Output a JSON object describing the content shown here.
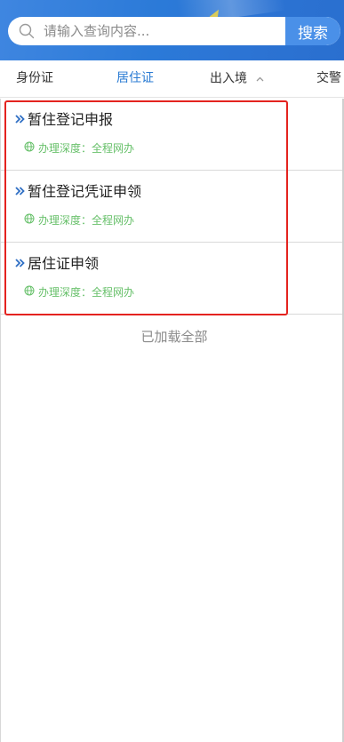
{
  "search": {
    "placeholder": "请输入查询内容...",
    "button_label": "搜索"
  },
  "tabs": [
    {
      "label": "身份证",
      "active": false
    },
    {
      "label": "居住证",
      "active": true
    },
    {
      "label": "出入境",
      "active": false
    },
    {
      "label": "交警",
      "active": false
    }
  ],
  "items": [
    {
      "title": "暂住登记申报",
      "meta": "办理深度：全程网办"
    },
    {
      "title": "暂住登记凭证申领",
      "meta": "办理深度：全程网办"
    },
    {
      "title": "居住证申领",
      "meta": "办理深度：全程网办"
    }
  ],
  "footer": {
    "text": "已加载全部"
  },
  "colors": {
    "header": "#2b7ad8",
    "search_button": "#4a90e8",
    "active_tab": "#2a7bd3",
    "meta_green": "#67c06a",
    "highlight_red": "#e4231f"
  },
  "icons": {
    "search": "search-icon",
    "dropdown": "chevron-up-icon",
    "item_arrow": "double-chevron-right-icon",
    "meta": "globe-icon"
  }
}
